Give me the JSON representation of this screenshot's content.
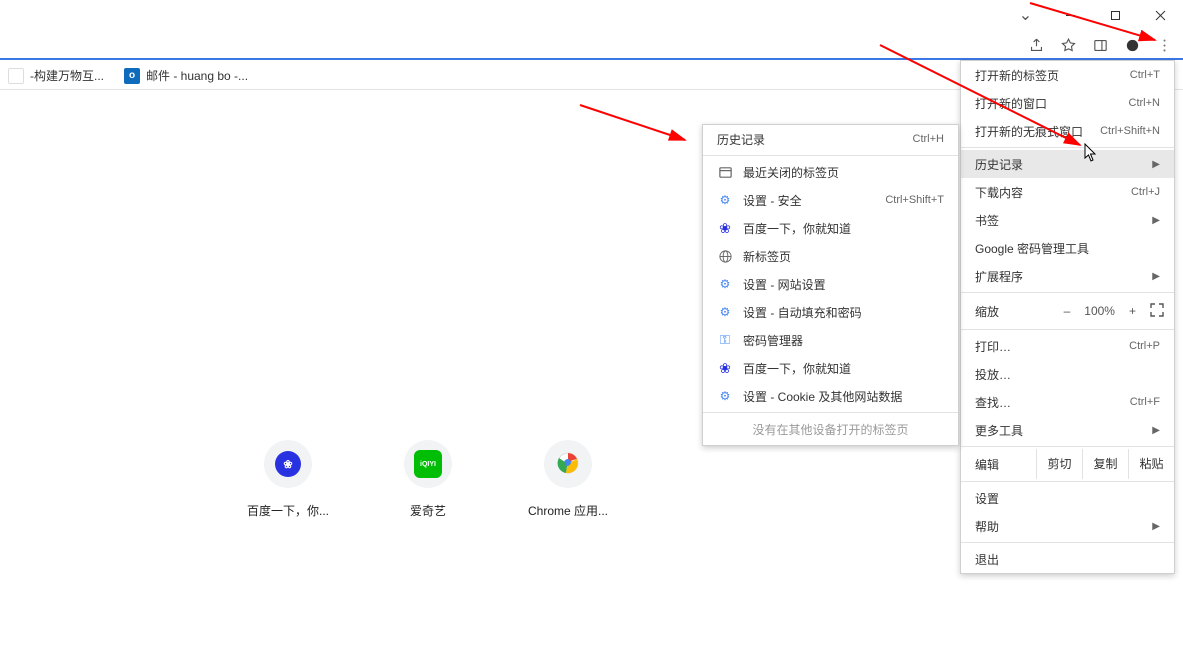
{
  "titlebar": {
    "minimize": "–",
    "maximize": "☐",
    "close": "✕",
    "dropdown": "⌄"
  },
  "bookmarks": [
    {
      "label": "-构建万物互...",
      "favicon_bg": "#ffffff",
      "favicon_text": "",
      "favicon_color": "#2b7de9"
    },
    {
      "label": "邮件 - huang bo -...",
      "favicon_bg": "#0F6CBD",
      "favicon_text": "O",
      "favicon_color": "#ffffff"
    }
  ],
  "shortcuts": [
    {
      "label": "百度一下，你...",
      "icon_bg": "#2b63ff",
      "icon_text": "百"
    },
    {
      "label": "爱奇艺",
      "icon_bg": "#00be06",
      "icon_text": "iQIYI"
    },
    {
      "label": "Chrome 应用...",
      "icon_bg": "#ffffff",
      "icon_text": ""
    }
  ],
  "main_menu": {
    "items_top": [
      {
        "label": "打开新的标签页",
        "shortcut": "Ctrl+T"
      },
      {
        "label": "打开新的窗口",
        "shortcut": "Ctrl+N"
      },
      {
        "label": "打开新的无痕式窗口",
        "shortcut": "Ctrl+Shift+N"
      }
    ],
    "history": {
      "label": "历史记录",
      "has_sub": true
    },
    "downloads": {
      "label": "下载内容",
      "shortcut": "Ctrl+J"
    },
    "bookmarks": {
      "label": "书签",
      "has_sub": true
    },
    "pwmgr": {
      "label": "Google 密码管理工具"
    },
    "extensions": {
      "label": "扩展程序",
      "has_sub": true
    },
    "zoom": {
      "label": "缩放",
      "minus": "–",
      "value": "100%",
      "plus": "+"
    },
    "print": {
      "label": "打印…",
      "shortcut": "Ctrl+P"
    },
    "cast": {
      "label": "投放…"
    },
    "find": {
      "label": "查找…",
      "shortcut": "Ctrl+F"
    },
    "more_tools": {
      "label": "更多工具",
      "has_sub": true
    },
    "edit": {
      "label": "编辑",
      "cut": "剪切",
      "copy": "复制",
      "paste": "粘贴"
    },
    "settings": {
      "label": "设置"
    },
    "help": {
      "label": "帮助",
      "has_sub": true
    },
    "exit": {
      "label": "退出"
    }
  },
  "sub_menu": {
    "header": {
      "label": "历史记录",
      "shortcut": "Ctrl+H"
    },
    "recent_label": "最近关闭的标签页",
    "items": [
      {
        "icon": "gear",
        "label": "设置 - 安全",
        "shortcut": "Ctrl+Shift+T"
      },
      {
        "icon": "baidu",
        "label": "百度一下，你就知道"
      },
      {
        "icon": "globe",
        "label": "新标签页"
      },
      {
        "icon": "gear",
        "label": "设置 - 网站设置"
      },
      {
        "icon": "gear",
        "label": "设置 - 自动填充和密码"
      },
      {
        "icon": "key",
        "label": "密码管理器"
      },
      {
        "icon": "baidu",
        "label": "百度一下，你就知道"
      },
      {
        "icon": "gear",
        "label": "设置 - Cookie 及其他网站数据"
      }
    ],
    "no_other": "没有在其他设备打开的标签页"
  },
  "colors": {
    "blue": "#4285f4",
    "red_arrow": "#ff0000"
  }
}
